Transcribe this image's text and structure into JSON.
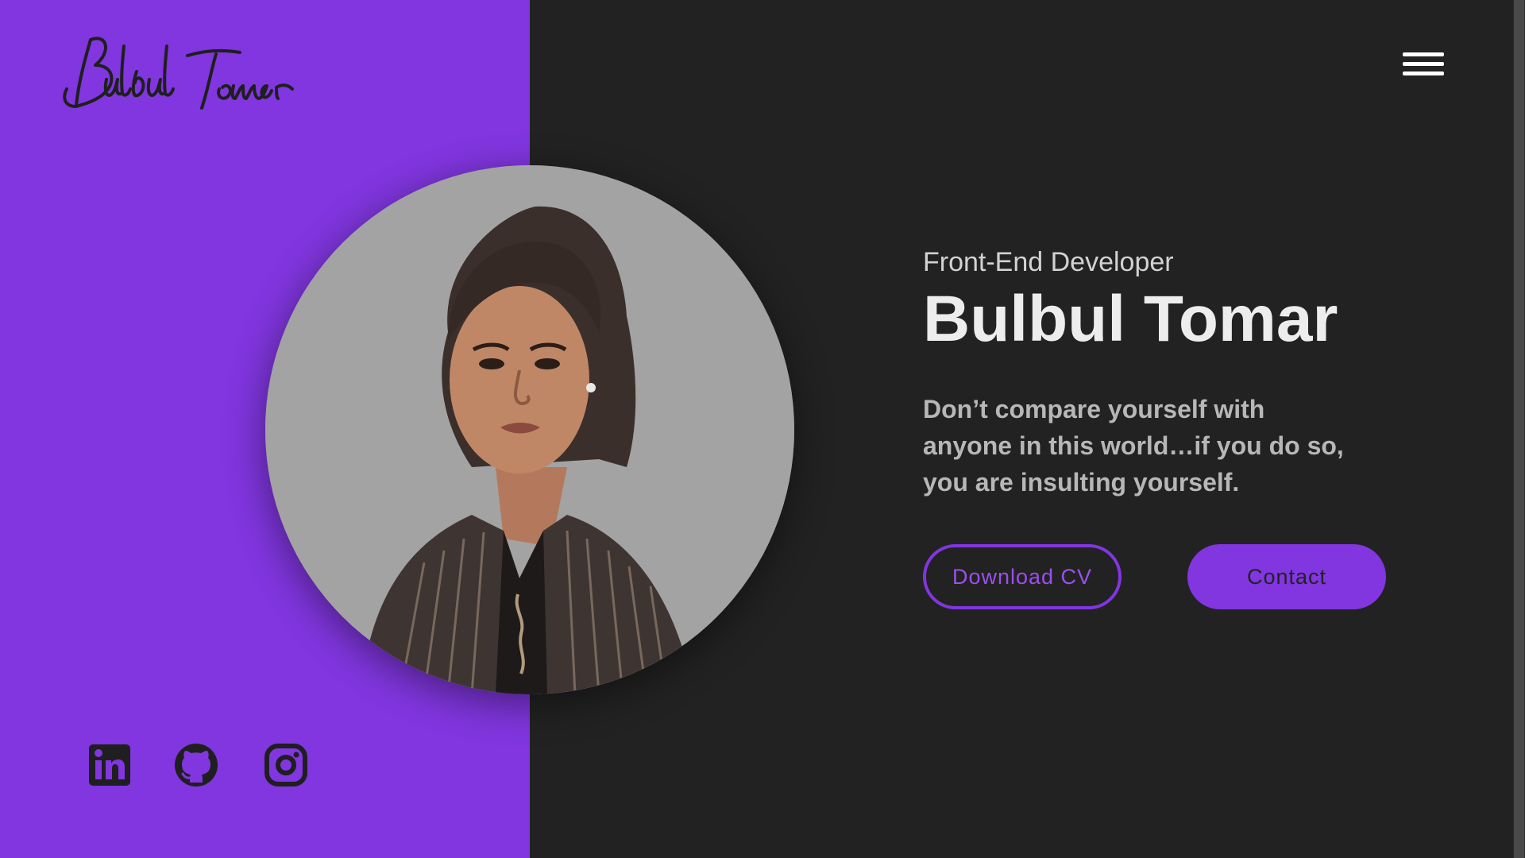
{
  "logo": {
    "text": "Bulbul Tomar",
    "style": "handwritten-signature"
  },
  "nav": {
    "menu_icon": "hamburger-menu-icon"
  },
  "hero": {
    "role": "Front-End Developer",
    "name": "Bulbul Tomar",
    "quote_lines": [
      "Don’t compare yourself with",
      "anyone in this world…if you do so,",
      "you are insulting yourself."
    ]
  },
  "buttons": {
    "download_label": "Download CV",
    "contact_label": "Contact"
  },
  "social": [
    {
      "name": "linkedin",
      "icon": "linkedin-icon"
    },
    {
      "name": "github",
      "icon": "github-icon"
    },
    {
      "name": "instagram",
      "icon": "instagram-icon"
    }
  ],
  "colors": {
    "accent": "#8136df",
    "dark_bg": "#222222",
    "text_light": "#ededed",
    "text_muted": "#b7b7b7",
    "icon_dark": "#1f1f1f"
  }
}
